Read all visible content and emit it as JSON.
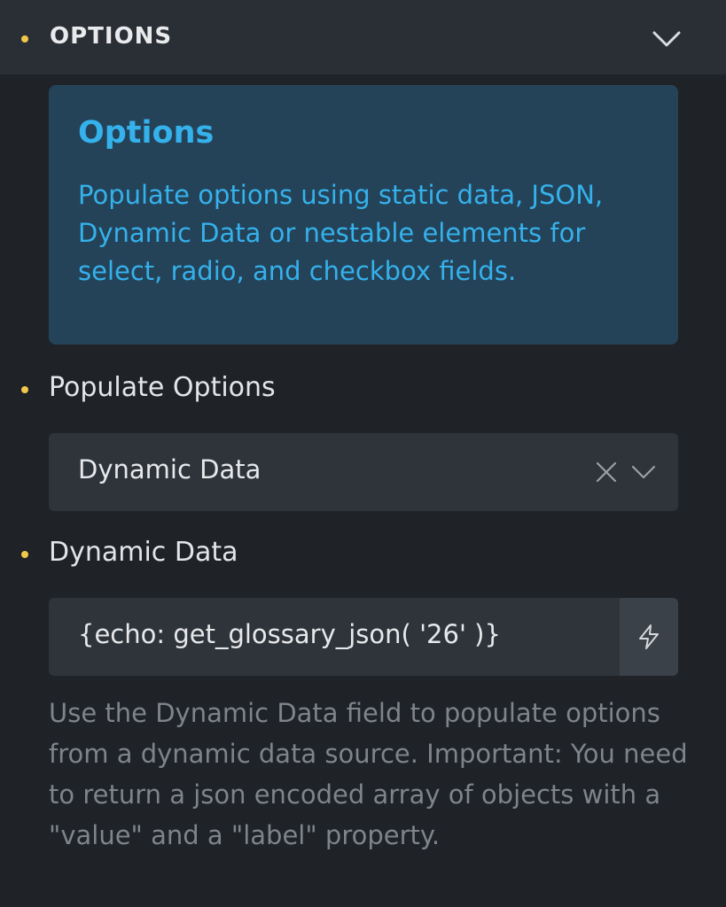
{
  "header": {
    "title": "OPTIONS",
    "toggle_icon": "chevron-down-icon"
  },
  "info": {
    "title": "Options",
    "text": "Populate options using static data, JSON, Dynamic Data or nestable elements for select, radio, and checkbox fields."
  },
  "populate": {
    "label": "Populate Options",
    "selected": "Dynamic Data",
    "clear_icon": "close-icon",
    "caret_icon": "chevron-down-icon"
  },
  "dynamic_data": {
    "label": "Dynamic Data",
    "value": "{echo: get_glossary_json( '26' )}",
    "button_icon": "lightning-bolt-icon"
  },
  "help": {
    "text": "Use the Dynamic Data field to populate options from a dynamic data source. Important: You need to return a json encoded array of objects with a \"value\" and a \"label\" property."
  },
  "colors": {
    "accent_dot": "#f2c84b",
    "info_text": "#35b1eb",
    "info_bg": "#244359"
  }
}
